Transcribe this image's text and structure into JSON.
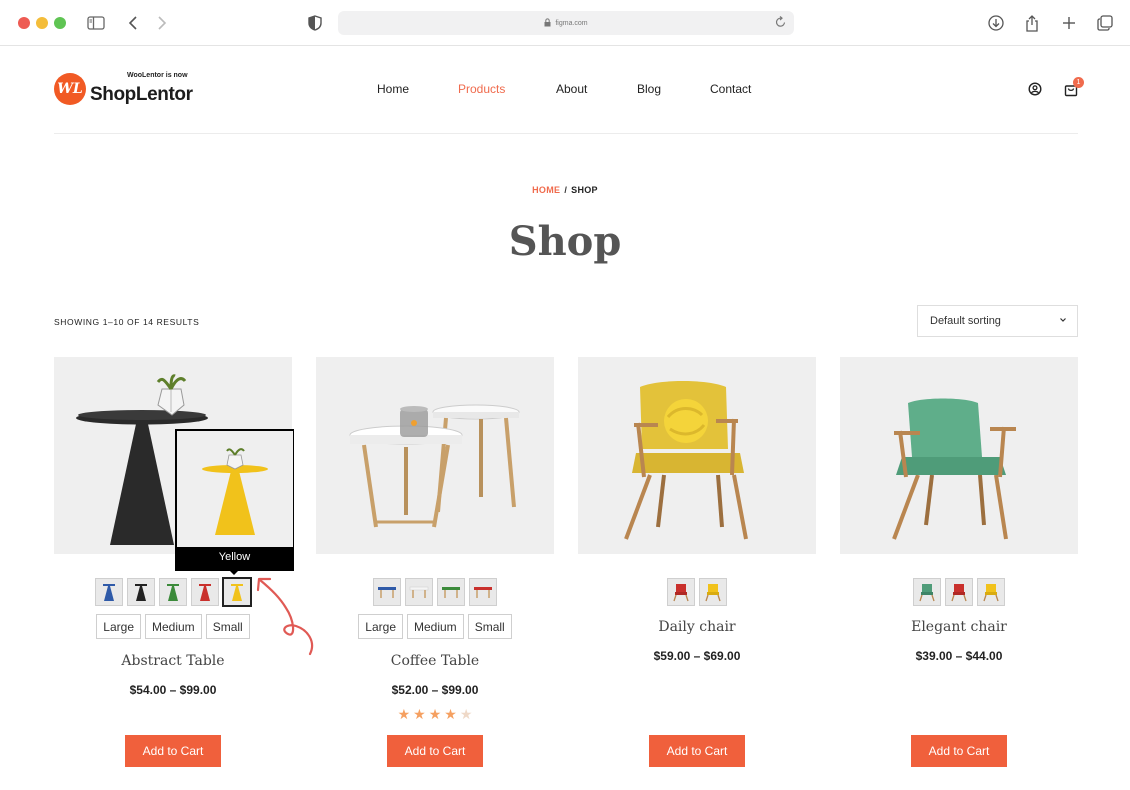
{
  "browser": {
    "url": "figma.com",
    "icons": [
      "sidebar-icon",
      "back-icon",
      "forward-icon",
      "shield-icon",
      "lock-icon",
      "reload-icon",
      "download-icon",
      "share-icon",
      "new-tab-icon",
      "tabs-icon"
    ]
  },
  "brand": {
    "tagline": "WooLentor is now",
    "name": "ShopLentor",
    "badge": "WL"
  },
  "nav": {
    "items": [
      {
        "label": "Home",
        "active": false
      },
      {
        "label": "Products",
        "active": true
      },
      {
        "label": "About",
        "active": false
      },
      {
        "label": "Blog",
        "active": false
      },
      {
        "label": "Contact",
        "active": false
      }
    ],
    "cart_count": "1",
    "accent": "#f06b4d"
  },
  "breadcrumb": {
    "home": "HOME",
    "separator": "/",
    "current": "SHOP"
  },
  "page": {
    "title": "Shop",
    "result_count": "SHOWING 1–10 OF 14 RESULTS",
    "sorting": "Default sorting"
  },
  "products": [
    {
      "title": "Abstract Table",
      "price": "$54.00 – $99.00",
      "swatches": [
        "blue",
        "black",
        "green",
        "red",
        "yellow"
      ],
      "selected_swatch": "yellow",
      "sizes": [
        "Large",
        "Medium",
        "Small"
      ],
      "button": "Add to Cart",
      "tooltip": "Yellow"
    },
    {
      "title": "Coffee Table",
      "price": "$52.00 – $99.00",
      "swatches": [
        "blue",
        "natural",
        "green",
        "red"
      ],
      "sizes": [
        "Large",
        "Medium",
        "Small"
      ],
      "rating": 4,
      "rating_max": 5,
      "button": "Add to Cart"
    },
    {
      "title": "Daily chair",
      "price": "$59.00 – $69.00",
      "swatches": [
        "red",
        "yellow"
      ],
      "button": "Add to Cart"
    },
    {
      "title": "Elegant chair",
      "price": "$39.00 – $44.00",
      "swatches": [
        "green",
        "red",
        "yellow"
      ],
      "button": "Add to Cart"
    }
  ],
  "colors": {
    "button": "#f0603c",
    "card_bg": "#efefef",
    "swatch_blue": "#2f5aa8",
    "swatch_black": "#222222",
    "swatch_green": "#3b8a3a",
    "swatch_red": "#c9302c",
    "swatch_yellow": "#f1c21b"
  }
}
